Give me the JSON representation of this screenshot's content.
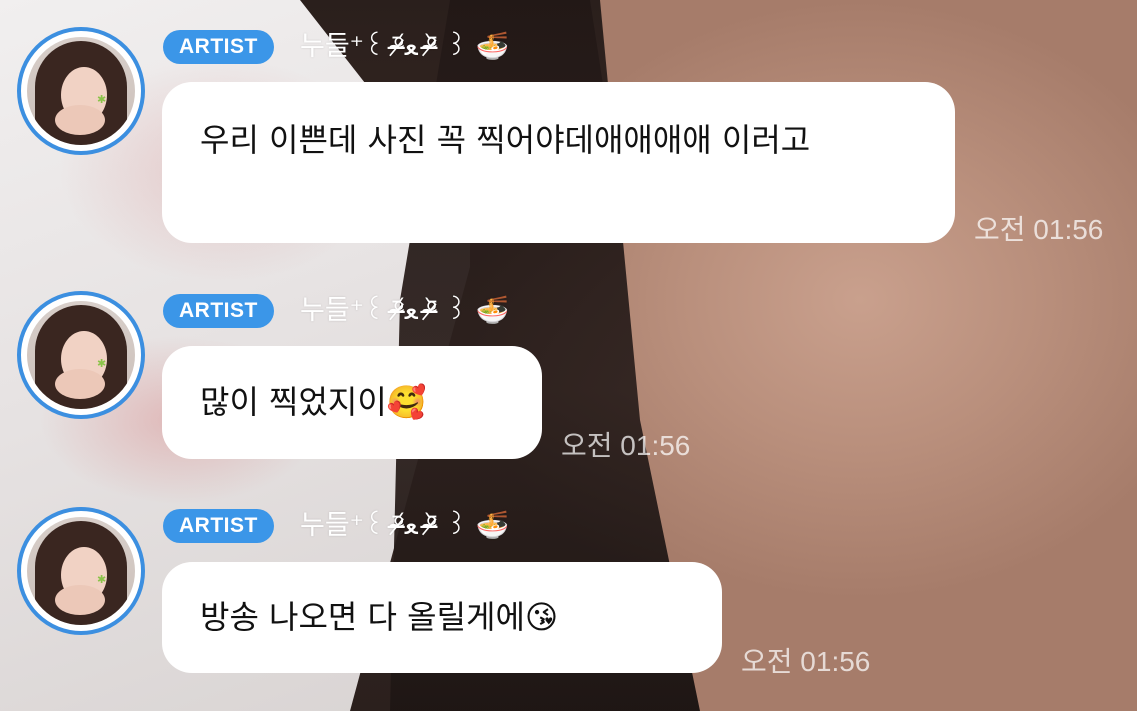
{
  "messages": [
    {
      "badge": "ARTIST",
      "name": "누들⁺꒰ ᵒ̴̶̷᷄ﻌ ᵒ̴̶̷᷅ ꒱ 🍜",
      "text": "우리 이쁜데 사진 꼭 찍어야데애애애애 이러고",
      "time": "오전 01:56"
    },
    {
      "badge": "ARTIST",
      "name": "누들⁺꒰ ᵒ̴̶̷᷄ﻌ ᵒ̴̶̷᷅ ꒱ 🍜",
      "text": "많이 찍었지이🥰",
      "time": "오전 01:56"
    },
    {
      "badge": "ARTIST",
      "name": "누들⁺꒰ ᵒ̴̶̷᷄ﻌ ᵒ̴̶̷᷅ ꒱ 🍜",
      "text": "방송 나오면 다 올릴게에😘",
      "time": "오전 01:56"
    }
  ],
  "colors": {
    "badge": "#3b96e8",
    "avatar_ring": "#3c8fe0",
    "bubble": "#ffffff"
  }
}
